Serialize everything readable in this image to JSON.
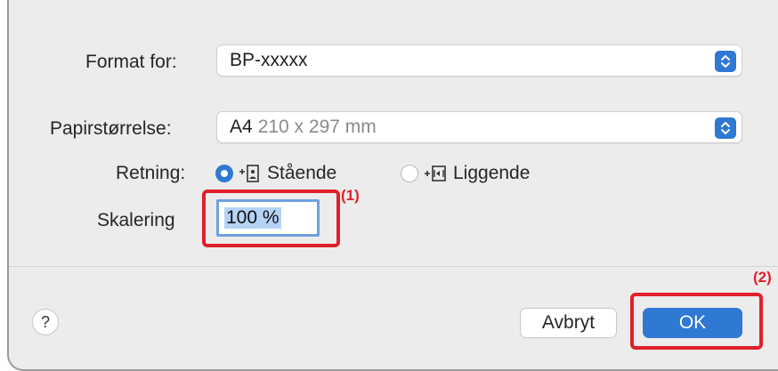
{
  "format_for": {
    "label": "Format for:",
    "value": "BP-xxxxx"
  },
  "paper_size": {
    "label": "Papirstørrelse:",
    "value": "A4",
    "value_detail": "210 x 297 mm"
  },
  "orientation": {
    "label": "Retning:",
    "portrait_label": "Stående",
    "landscape_label": "Liggende",
    "selected": "portrait"
  },
  "scale": {
    "label": "Skalering",
    "value": "100 %"
  },
  "callouts": {
    "scale": "(1)",
    "ok": "(2)"
  },
  "buttons": {
    "help": "?",
    "cancel": "Avbryt",
    "ok": "OK"
  },
  "colors": {
    "accent": "#2f78d4",
    "highlight": "#e0202a"
  }
}
